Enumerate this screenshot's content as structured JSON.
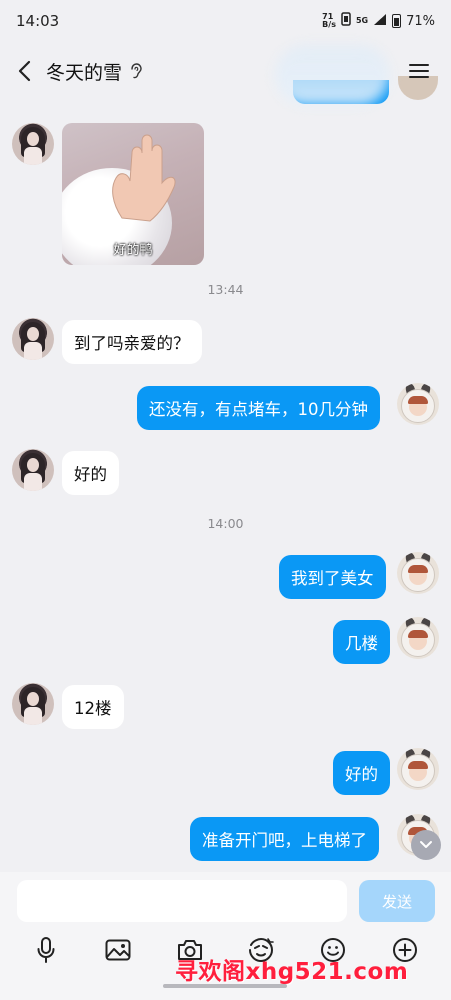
{
  "status_bar": {
    "time": "14:03",
    "network_speed": "71\nB/s",
    "network_type": "5G",
    "battery": "71%"
  },
  "header": {
    "title": "冬天的雪"
  },
  "messages": [
    {
      "side": "left",
      "type": "sticker",
      "caption": "好的鸭"
    },
    {
      "side": "time",
      "text": "13:44"
    },
    {
      "side": "left",
      "text": "到了吗亲爱的？"
    },
    {
      "side": "right",
      "text": "还没有，有点堵车，10几分钟"
    },
    {
      "side": "left",
      "text": "好的"
    },
    {
      "side": "time",
      "text": "14:00"
    },
    {
      "side": "right",
      "text": "我到了美女"
    },
    {
      "side": "right",
      "text": "几楼"
    },
    {
      "side": "left",
      "text": "12楼"
    },
    {
      "side": "right",
      "text": "好的"
    },
    {
      "side": "right",
      "text": "准备开门吧，上电梯了"
    }
  ],
  "input": {
    "placeholder": "",
    "send_label": "发送"
  },
  "toolbar": [
    "mic-icon",
    "image-icon",
    "camera-icon",
    "sticker-icon",
    "emoji-icon",
    "plus-icon"
  ],
  "watermark": "寻欢阁xhg521.com",
  "colors": {
    "accent": "#0a98f5",
    "background": "#f0f0f3",
    "send_disabled": "#a5d6fb",
    "watermark": "#ff1f3d"
  }
}
